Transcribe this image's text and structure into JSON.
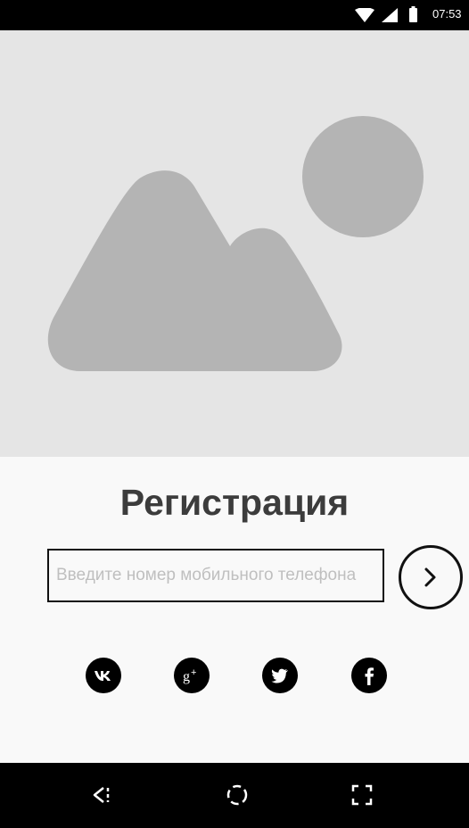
{
  "status_bar": {
    "time": "07:53",
    "icons": [
      "wifi-icon",
      "signal-icon",
      "battery-icon"
    ]
  },
  "hero": {
    "icon": "image-placeholder-icon",
    "background_color": "#e5e5e5",
    "shape_color": "#b4b4b4"
  },
  "registration": {
    "title": "Регистрация",
    "phone_placeholder": "Введите номер мобильного телефона",
    "phone_value": "",
    "next_icon": "chevron-right-icon"
  },
  "social": [
    {
      "name": "vk",
      "icon": "vk-icon"
    },
    {
      "name": "google-plus",
      "icon": "google-plus-icon"
    },
    {
      "name": "twitter",
      "icon": "twitter-icon"
    },
    {
      "name": "facebook",
      "icon": "facebook-icon"
    }
  ],
  "nav_bar": {
    "buttons": [
      "back-icon",
      "home-icon",
      "recents-icon"
    ]
  }
}
